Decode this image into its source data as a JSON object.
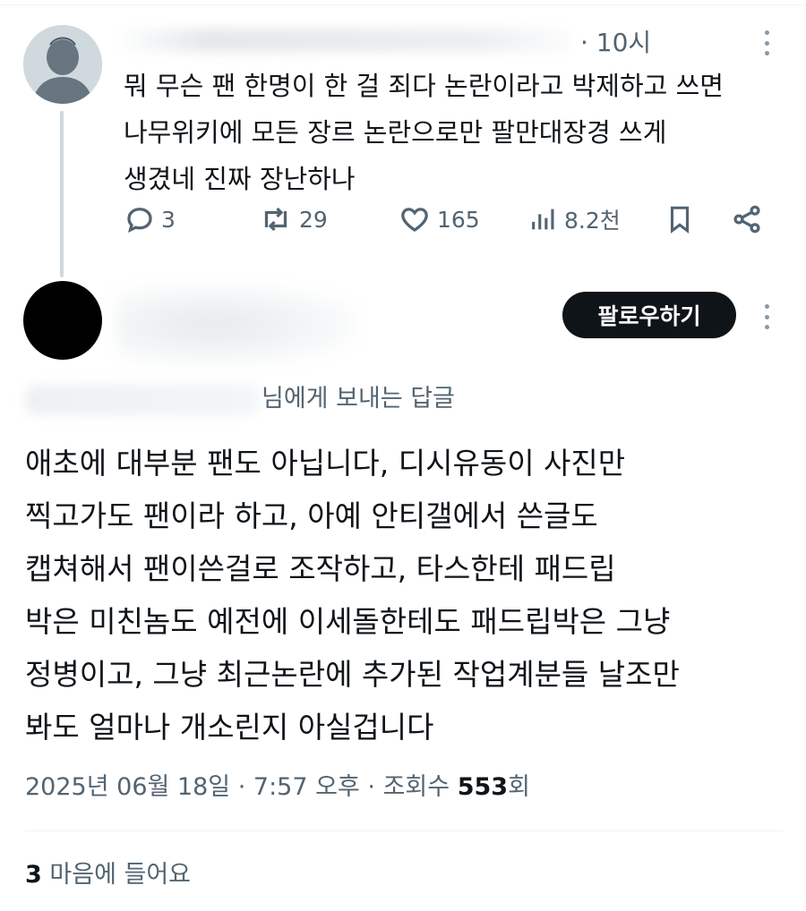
{
  "parent_tweet": {
    "time": "· 10시",
    "text": "뭐 무슨 팬 한명이 한 걸 죄다 논란이라고 박제하고 쓰면\n나무위키에 모든 장르 논란으로만 팔만대장경 쓰게\n생겼네 진짜 장난하나",
    "replies": "3",
    "reposts": "29",
    "likes": "165",
    "views": "8.2천"
  },
  "main_tweet": {
    "follow_label": "팔로우하기",
    "reply_to": "님에게 보내는 답글",
    "text": "애초에 대부분 팬도 아닙니다, 디시유동이 사진만\n찍고가도 팬이라 하고, 아예 안티갤에서 쓴글도\n캡쳐해서 팬이쓴걸로 조작하고, 타스한테 패드립\n박은 미친놈도 예전에 이세돌한테도 패드립박은 그냥\n정병이고, 그냥 최근논란에 추가된 작업계분들 날조만\n봐도 얼마나 개소린지 아실겁니다",
    "date": "2025년 06월 18일",
    "time": "7:57 오후",
    "views_label": "조회수",
    "views_count": "553",
    "views_suffix": "회",
    "like_count": "3",
    "like_label": "마음에 들어요"
  },
  "icons": [
    "avatar-default-icon",
    "more-icon",
    "reply-icon",
    "repost-icon",
    "like-icon",
    "views-icon",
    "bookmark-icon",
    "share-icon"
  ],
  "colors": {
    "text": "#0f1419",
    "secondary": "#536471",
    "follow_bg": "#0f1419",
    "thread_line": "#cfd9de"
  }
}
